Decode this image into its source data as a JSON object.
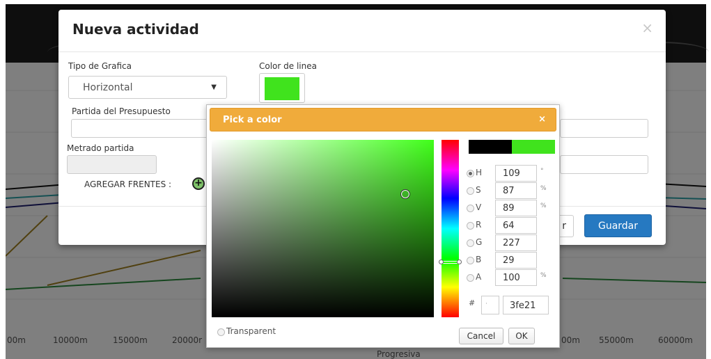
{
  "background": {
    "x_ticks": [
      "00m",
      "10000m",
      "15000m",
      "20000r",
      "00m",
      "55000m",
      "60000m"
    ],
    "x_label": "Progresiva"
  },
  "modal": {
    "title": "Nueva actividad",
    "close_symbol": "×",
    "tipo_grafica_label": "Tipo de Grafica",
    "tipo_grafica_value": "Horizontal",
    "color_linea_label": "Color de linea",
    "color_linea_value": "#40e31d",
    "partida_label": "Partida del Presupuesto",
    "partida_value": "",
    "metrado_label": "Metrado partida",
    "metrado_value": "",
    "agregar_label": "AGREGAR FRENTES :",
    "cancel_partial_label": "r",
    "save_label": "Guardar"
  },
  "picker": {
    "title": "Pick a color",
    "close_symbol": "×",
    "previous_color": "#000000",
    "new_color": "#40e31d",
    "channels": [
      {
        "name": "H",
        "value": "109",
        "unit": "°",
        "selected": true
      },
      {
        "name": "S",
        "value": "87",
        "unit": "%",
        "selected": false
      },
      {
        "name": "V",
        "value": "89",
        "unit": "%",
        "selected": false
      },
      {
        "name": "R",
        "value": "64",
        "unit": "",
        "selected": false
      },
      {
        "name": "G",
        "value": "227",
        "unit": "",
        "selected": false
      },
      {
        "name": "B",
        "value": "29",
        "unit": "",
        "selected": false
      },
      {
        "name": "A",
        "value": "100",
        "unit": "%",
        "selected": false
      }
    ],
    "hash_label": "#",
    "hex_prefix": "·",
    "hex_value": "3fe21",
    "transparent_label": "Transparent",
    "cancel_label": "Cancel",
    "ok_label": "OK"
  },
  "colors": {
    "accent": "#2679c1",
    "header": "#f0ab3b"
  }
}
